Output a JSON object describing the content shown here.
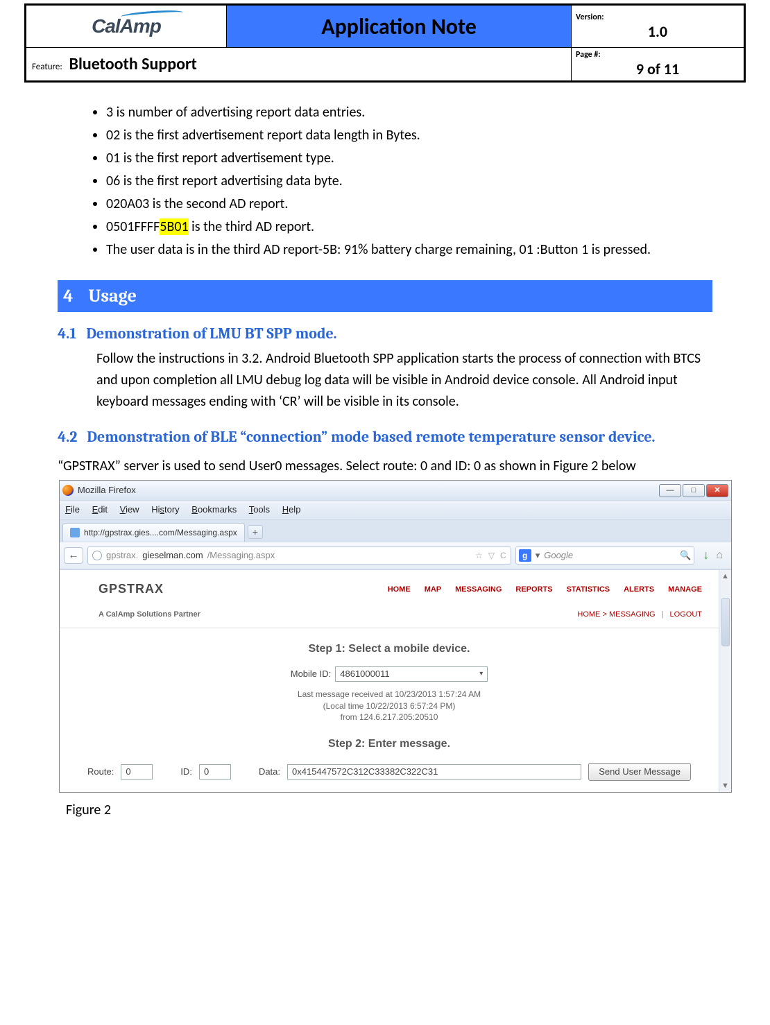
{
  "header": {
    "logo_text": "CalAmp",
    "title": "Application Note",
    "version_label": "Version:",
    "version_value": "1.0",
    "feature_label": "Feature:",
    "feature_value": "Bluetooth Support",
    "page_label": "Page #:",
    "page_value": "9 of 11"
  },
  "bullets": {
    "b0": "3 is number of advertising report data entries.",
    "b1": "02 is the first advertisement report data length in Bytes.",
    "b2": "01 is the first report advertisement type.",
    "b3": "06 is the first report advertising data byte.",
    "b4": "020A03 is the second AD report.",
    "b5_pre": "0501FFFF",
    "b5_hl": "5B01",
    "b5_post": " is the third AD report.",
    "b6": "The user data is in the third AD report-5B: 91% battery charge remaining, 01 :Button 1 is pressed."
  },
  "sections": {
    "s4_num": "4",
    "s4_title": "Usage",
    "s41_num": "4.1",
    "s41_title": "Demonstration of LMU BT SPP mode.",
    "s41_body": "Follow the instructions in 3.2. Android Bluetooth SPP application  starts the process of connection with BTCS and upon completion all LMU debug log data will be visible in Android device console. All Android input keyboard messages  ending with ‘CR’ will be visible in its console.",
    "s42_num": "4.2",
    "s42_title": "Demonstration of BLE “connection” mode based remote temperature sensor device.",
    "s42_body": "“GPSTRAX” server is used to send User0 messages. Select route: 0 and ID: 0 as shown in Figure 2 below",
    "fig_caption": "Figure 2"
  },
  "firefox": {
    "window_title": "Mozilla Firefox",
    "menu": {
      "file": "File",
      "edit": "Edit",
      "view": "View",
      "history": "History",
      "bookmarks": "Bookmarks",
      "tools": "Tools",
      "help": "Help"
    },
    "tab_title": "http://gpstrax.gies....com/Messaging.aspx",
    "addtab": "+",
    "back": "←",
    "url_pre": "gpstrax.",
    "url_host": "gieselman.com",
    "url_post": "/Messaging.aspx",
    "url_star": "☆",
    "url_drop": "▽",
    "url_reload": "C",
    "search_placeholder": "Google",
    "search_dropdown": "▾",
    "win_min": "—",
    "win_max": "□",
    "win_close": "✕",
    "mag": "🔍",
    "dl": "↓",
    "home": "⌂"
  },
  "site": {
    "logo": "GPSTRAX",
    "nav": {
      "home": "HOME",
      "map": "MAP",
      "messaging": "MESSAGING",
      "reports": "REPORTS",
      "statistics": "STATISTICS",
      "alerts": "ALERTS",
      "manage": "MANAGE"
    },
    "tagline": "A CalAmp Solutions Partner",
    "crumb_home": "HOME",
    "crumb_gt": ">",
    "crumb_messaging": "MESSAGING",
    "crumb_sep": "|",
    "crumb_logout": "LOGOUT",
    "step1": "Step 1: Select a mobile device.",
    "mobile_id_label": "Mobile ID:",
    "mobile_id_value": "4861000011",
    "caret": "▾",
    "meta_line1": "Last message received at 10/23/2013 1:57:24 AM",
    "meta_line2": "(Local time 10/22/2013 6:57:24 PM)",
    "meta_line3": "from 124.6.217.205:20510",
    "step2": "Step 2: Enter message.",
    "route_label": "Route:",
    "route_value": "0",
    "id_label": "ID:",
    "id_value": "0",
    "data_label": "Data:",
    "data_value": "0x415447572C312C33382C322C31",
    "send_btn": "Send User Message"
  }
}
